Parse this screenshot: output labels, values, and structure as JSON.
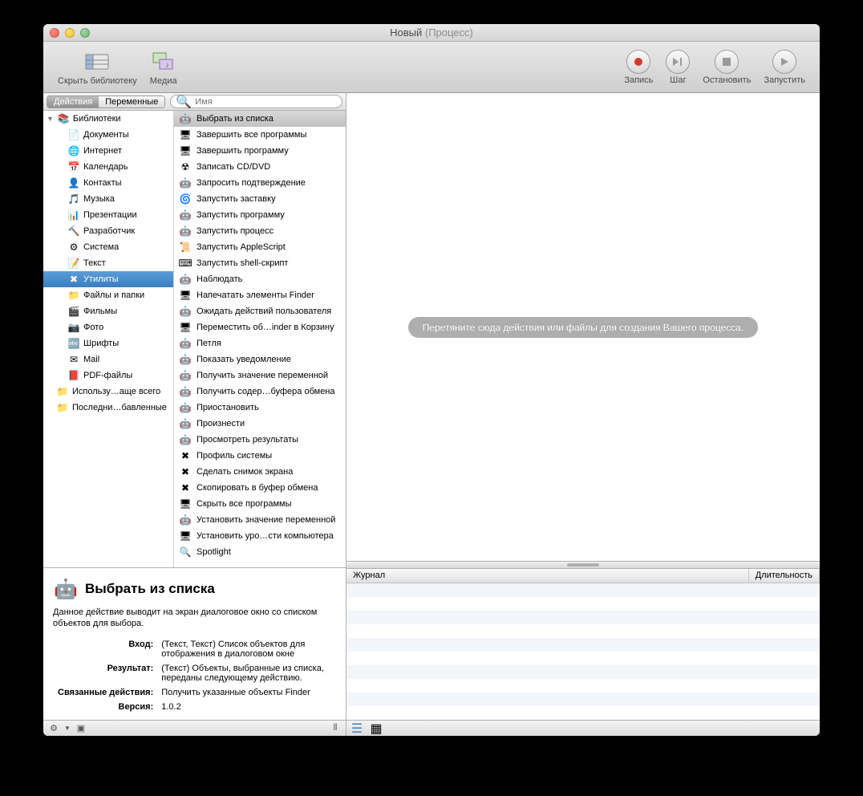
{
  "window": {
    "title_main": "Новый",
    "title_sub": "(Процесс)"
  },
  "toolbar": {
    "hide_library": "Скрыть библиотеку",
    "media": "Медиа",
    "record": "Запись",
    "step": "Шаг",
    "stop": "Остановить",
    "run": "Запустить"
  },
  "tabs": {
    "actions": "Действия",
    "variables": "Переменные"
  },
  "search": {
    "placeholder": "Имя"
  },
  "sidebar": {
    "root": "Библиотеки",
    "items": [
      "Документы",
      "Интернет",
      "Календарь",
      "Контакты",
      "Музыка",
      "Презентации",
      "Разработчик",
      "Система",
      "Текст",
      "Утилиты",
      "Файлы и папки",
      "Фильмы",
      "Фото",
      "Шрифты",
      "Mail",
      "PDF-файлы"
    ],
    "bottom": [
      "Использу…аще всего",
      "Последни…бавленные"
    ],
    "selected_index": 9
  },
  "actions_list": {
    "selected_index": 0,
    "items": [
      "Выбрать из списка",
      "Завершить все программы",
      "Завершить программу",
      "Записать CD/DVD",
      "Запросить подтверждение",
      "Запустить заставку",
      "Запустить программу",
      "Запустить процесс",
      "Запустить AppleScript",
      "Запустить shell-скрипт",
      "Наблюдать",
      "Напечатать элементы Finder",
      "Ожидать действий пользователя",
      "Переместить об…inder в Корзину",
      "Петля",
      "Показать уведомление",
      "Получить значение переменной",
      "Получить содер…буфера обмена",
      "Приостановить",
      "Произнести",
      "Просмотреть результаты",
      "Профиль системы",
      "Сделать снимок экрана",
      "Скопировать в буфер обмена",
      "Скрыть все программы",
      "Установить значение переменной",
      "Установить уро…сти компьютера",
      "Spotlight"
    ]
  },
  "canvas": {
    "hint": "Перетяните сюда действия или файлы для создания Вашего процесса."
  },
  "log": {
    "col1": "Журнал",
    "col2": "Длительность"
  },
  "info": {
    "title": "Выбрать из списка",
    "desc": "Данное действие выводит на экран диалоговое окно со списком объектов для выбора.",
    "input_k": "Вход:",
    "input_v": "(Текст, Текст) Список объектов для отображения в диалоговом окне",
    "result_k": "Результат:",
    "result_v": "(Текст) Объекты, выбранные из списка, переданы следующему действию.",
    "related_k": "Связанные действия:",
    "related_v": "Получить указанные объекты Finder",
    "version_k": "Версия:",
    "version_v": "1.0.2"
  }
}
